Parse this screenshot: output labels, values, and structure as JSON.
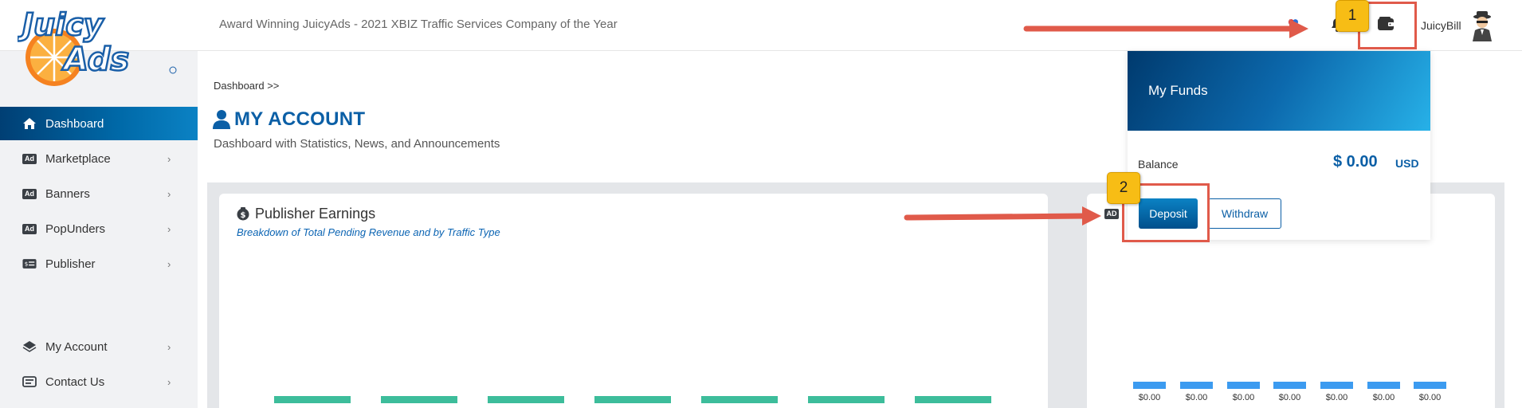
{
  "header": {
    "logo_text_line1": "Juicy",
    "logo_text_line2": "Ads",
    "tagline": "Award Winning JuicyAds - 2021 XBIZ Traffic Services Company of the Year",
    "username": "JuicyBill"
  },
  "sidebar": {
    "items": [
      {
        "label": "Dashboard",
        "icon": "home-icon",
        "active": true
      },
      {
        "label": "Marketplace",
        "icon": "ad-icon"
      },
      {
        "label": "Banners",
        "icon": "ad-icon"
      },
      {
        "label": "PopUnders",
        "icon": "ad-icon"
      },
      {
        "label": "Publisher",
        "icon": "publisher-icon"
      },
      {
        "label": "My Account",
        "icon": "layers-icon"
      },
      {
        "label": "Contact Us",
        "icon": "contact-icon"
      }
    ],
    "chevron": "›",
    "ad_badge": "Ad"
  },
  "main": {
    "breadcrumb": "Dashboard >>",
    "title": "MY ACCOUNT",
    "subtitle": "Dashboard with Statistics, News, and Announcements",
    "earnings_card": {
      "title": "Publisher Earnings",
      "subtitle": "Breakdown of Total Pending Revenue and by Traffic Type"
    },
    "right_card": {
      "ad_badge": "AD",
      "bar_labels": [
        "$0.00",
        "$0.00",
        "$0.00",
        "$0.00",
        "$0.00",
        "$0.00",
        "$0.00"
      ]
    }
  },
  "funds_popup": {
    "title": "My Funds",
    "balance_label": "Balance",
    "balance_value": "$ 0.00",
    "balance_currency": "USD",
    "deposit_label": "Deposit",
    "withdraw_label": "Withdraw"
  },
  "annotations": {
    "step1": "1",
    "step2": "2"
  },
  "colors": {
    "brand_blue": "#0b5fa6",
    "accent_orange": "#f58220",
    "green_bar": "#3dbd9b",
    "blue_bar": "#3c9bf0",
    "annotation_red": "#e05a4a",
    "annotation_yellow": "#f7bd15"
  }
}
